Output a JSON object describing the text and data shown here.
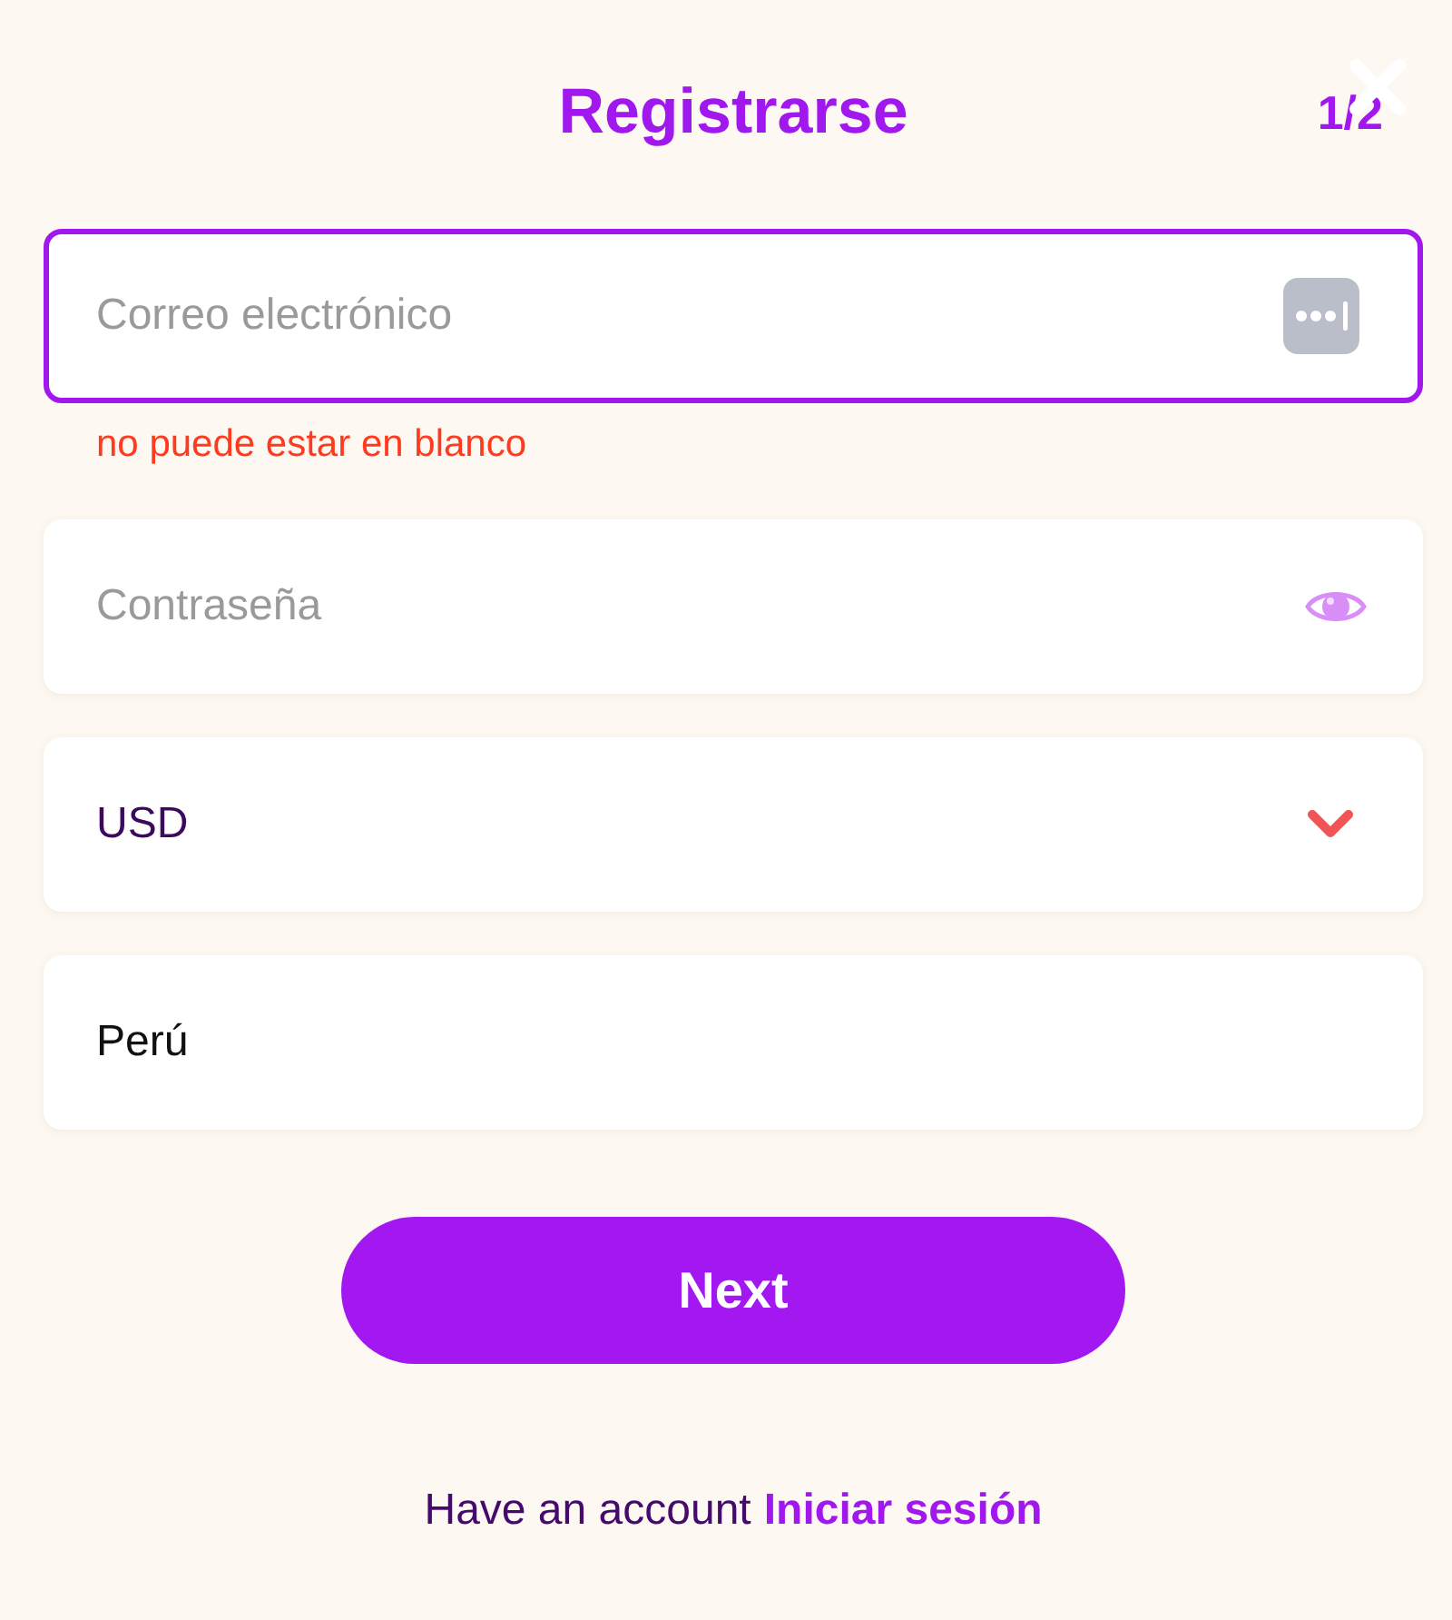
{
  "header": {
    "title": "Registrarse",
    "step": "1/2"
  },
  "fields": [
    {
      "kind": "email",
      "placeholder": "Correo electrónico",
      "focused": true,
      "error": "no puede estar en blanco"
    },
    {
      "kind": "password",
      "placeholder": "Contraseña",
      "focused": false
    },
    {
      "kind": "select",
      "value": "USD",
      "focused": false
    },
    {
      "kind": "text",
      "value": "Perú",
      "focused": false
    }
  ],
  "next_button": {
    "label": "Next"
  },
  "footer": {
    "text": "Have an account",
    "link": "Iniciar sesión"
  }
}
